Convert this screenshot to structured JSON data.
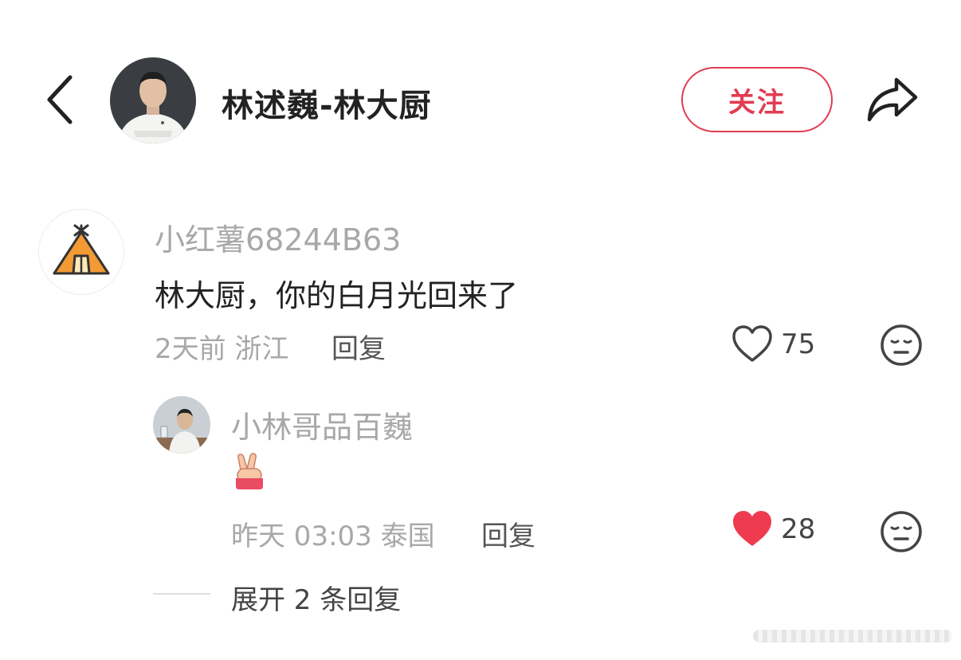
{
  "header": {
    "author_name": "林述巍-林大厨",
    "follow_label": "关注",
    "icons": {
      "back": "chevron-left-icon",
      "share": "share-arrow-icon"
    },
    "accent_color": "#e33c52"
  },
  "comment": {
    "username": "小红薯68244B63",
    "text": "林大厨，你的白月光回来了",
    "time": "2天前",
    "location": "浙江",
    "meta": "2天前 浙江",
    "reply_label": "回复",
    "likes": "75",
    "liked": false
  },
  "sub_reply": {
    "username": "小林哥品百巍",
    "emoji": "victory-hand",
    "time": "昨天 03:03",
    "location": "泰国",
    "meta": "昨天 03:03 泰国",
    "reply_label": "回复",
    "likes": "28",
    "liked": true,
    "like_color": "#ef3b50"
  },
  "expand": {
    "label": "展开 2 条回复"
  }
}
